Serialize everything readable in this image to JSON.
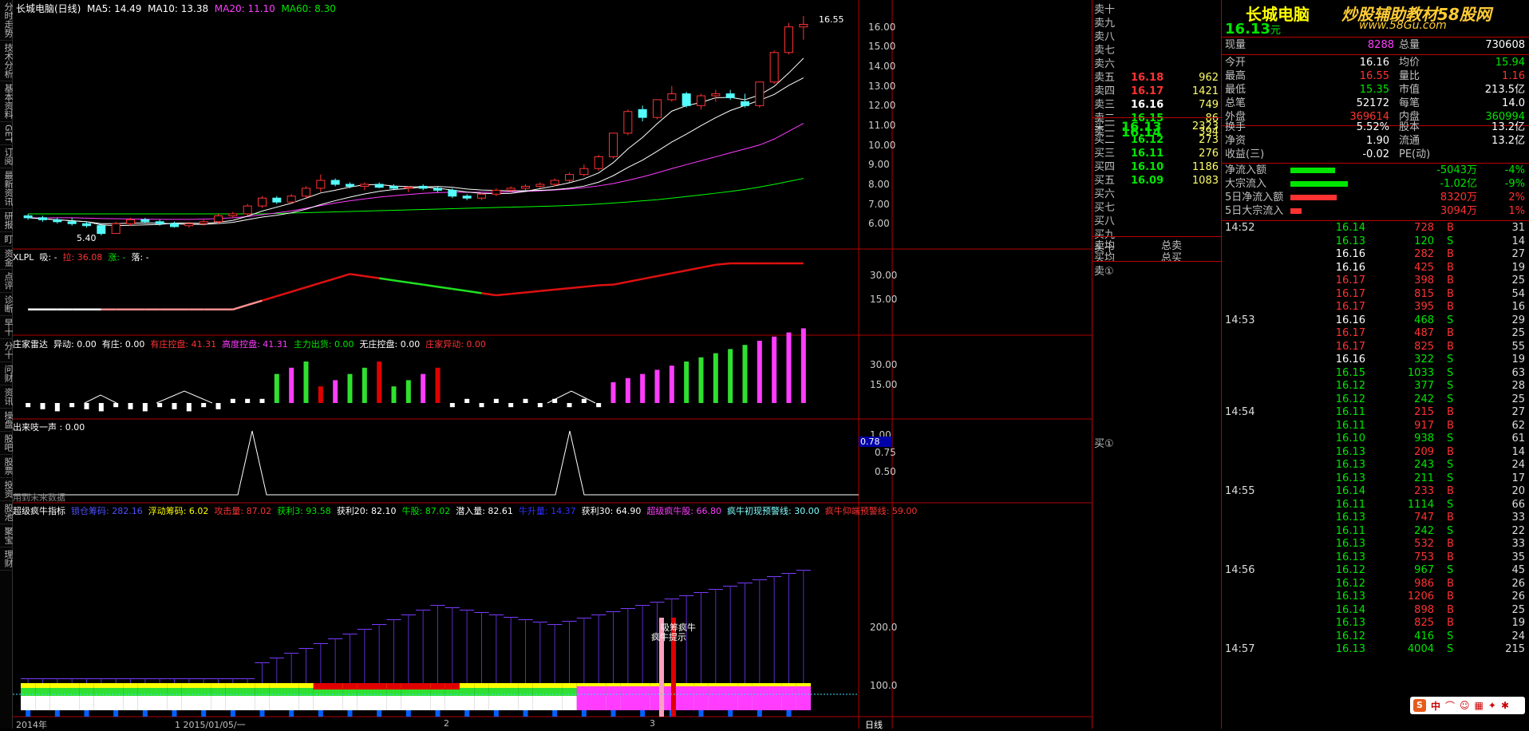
{
  "colors": {
    "up": "#ff3232",
    "down": "#54fcfc",
    "ma5": "#ffffff",
    "ma10": "#ffffff",
    "ma20": "#ff3cff",
    "ma60": "#00ff00",
    "grid": "#1a1a1a",
    "border": "#b00000"
  },
  "side_tabs": [
    "分时走势",
    "技术分析",
    "基本资料",
    "GET",
    "订阅",
    "最新资讯",
    "研报",
    "盯",
    "资金",
    "点评",
    "诊断",
    "早十",
    "分十",
    "问财",
    "资讯",
    "操盘",
    "股吧",
    "股票",
    "投资",
    "股池",
    "聚宝",
    "理财"
  ],
  "main": {
    "title": "长城电脑(日线)",
    "ma5": "MA5: 14.49",
    "ma10": "MA10: 13.38",
    "ma20": "MA20: 11.10",
    "ma60": "MA60: 8.30",
    "price_axis": [
      "16.00",
      "15.00",
      "14.00",
      "13.00",
      "12.00",
      "11.00",
      "10.00",
      "9.00",
      "8.00",
      "7.00",
      "6.00"
    ],
    "high_label": "16.55",
    "low_label": "5.40"
  },
  "p1": {
    "name": "XLPL",
    "a": "吸: -",
    "b": "拉: 36.08",
    "c": "涨: -",
    "d": "落: -",
    "axis": [
      "30.00",
      "15.00"
    ]
  },
  "p2": {
    "name": "庄家雷达",
    "a": "异动: 0.00",
    "b": "有庄: 0.00",
    "c": "有庄控盘: 41.31",
    "d": "高度控盘: 41.31",
    "e": "主力出货: 0.00",
    "f": "无庄控盘: 0.00",
    "g": "庄家异动: 0.00",
    "axis": [
      "30.00",
      "15.00"
    ]
  },
  "p3": {
    "name": "出来吱一声 : 0.00",
    "note": "用到未来数据",
    "axis": [
      "1.00",
      "0.75",
      "0.50"
    ],
    "marker": "0.78"
  },
  "p4": {
    "name": "超级疯牛指标",
    "a": "锁仓筹码: 282.16",
    "b": "浮动筹码: 6.02",
    "c": "攻击量: 87.02",
    "d": "获利3: 93.58",
    "e": "获利20: 82.10",
    "f": "牛股: 87.02",
    "g": "潜入量: 82.61",
    "h": "牛升量: 14.37",
    "i": "获利30: 64.90",
    "j": "超级疯牛股: 66.80",
    "k": "疯牛初现预警线: 30.00",
    "l": "疯牛仰端预警线: 59.00",
    "axis": [
      "200.0",
      "100.0"
    ],
    "ann1": "吸筹疯牛",
    "ann2": "疯牛提示"
  },
  "x_axis": {
    "a": "2014年",
    "b": "1 2015/01/05/一",
    "c": "2",
    "d": "3",
    "period": "日线"
  },
  "chart_data": {
    "type": "candlestick",
    "title": "长城电脑(日线)",
    "candles": [
      [
        6.4,
        6.5,
        6.2,
        6.3
      ],
      [
        6.3,
        6.4,
        6.1,
        6.2
      ],
      [
        6.2,
        6.3,
        6.0,
        6.1
      ],
      [
        6.1,
        6.3,
        5.9,
        6.0
      ],
      [
        6.0,
        6.1,
        5.8,
        5.9
      ],
      [
        5.9,
        6.0,
        5.4,
        5.5
      ],
      [
        5.5,
        6.1,
        5.5,
        6.0
      ],
      [
        6.0,
        6.3,
        5.9,
        6.2
      ],
      [
        6.2,
        6.3,
        6.0,
        6.1
      ],
      [
        6.1,
        6.2,
        5.9,
        6.0
      ],
      [
        6.0,
        6.1,
        5.8,
        5.85
      ],
      [
        5.9,
        6.1,
        5.8,
        6.0
      ],
      [
        6.0,
        6.2,
        5.9,
        6.1
      ],
      [
        6.1,
        6.5,
        6.0,
        6.4
      ],
      [
        6.4,
        6.6,
        6.3,
        6.5
      ],
      [
        6.5,
        7.0,
        6.4,
        6.9
      ],
      [
        6.9,
        7.4,
        6.8,
        7.3
      ],
      [
        7.3,
        7.4,
        7.0,
        7.1
      ],
      [
        7.1,
        7.5,
        7.0,
        7.4
      ],
      [
        7.4,
        7.9,
        7.3,
        7.8
      ],
      [
        7.8,
        8.5,
        7.6,
        8.2
      ],
      [
        8.2,
        8.3,
        7.9,
        8.0
      ],
      [
        8.0,
        8.1,
        7.8,
        7.9
      ],
      [
        7.9,
        8.1,
        7.7,
        8.0
      ],
      [
        8.0,
        8.1,
        7.8,
        7.85
      ],
      [
        7.9,
        8.0,
        7.7,
        7.8
      ],
      [
        7.8,
        7.9,
        7.6,
        7.85
      ],
      [
        7.9,
        8.0,
        7.7,
        7.8
      ],
      [
        7.8,
        7.9,
        7.6,
        7.7
      ],
      [
        7.7,
        7.8,
        7.3,
        7.4
      ],
      [
        7.4,
        7.5,
        7.2,
        7.3
      ],
      [
        7.3,
        7.6,
        7.2,
        7.5
      ],
      [
        7.5,
        7.8,
        7.4,
        7.7
      ],
      [
        7.7,
        7.9,
        7.6,
        7.8
      ],
      [
        7.8,
        8.0,
        7.7,
        7.9
      ],
      [
        7.9,
        8.1,
        7.8,
        8.0
      ],
      [
        8.0,
        8.3,
        7.9,
        8.2
      ],
      [
        8.2,
        8.6,
        8.1,
        8.5
      ],
      [
        8.5,
        9.0,
        8.4,
        8.8
      ],
      [
        8.8,
        9.5,
        8.7,
        9.4
      ],
      [
        9.4,
        10.6,
        9.3,
        10.6
      ],
      [
        10.6,
        11.8,
        10.5,
        11.7
      ],
      [
        11.8,
        12.0,
        11.2,
        11.4
      ],
      [
        11.4,
        12.3,
        11.3,
        12.3
      ],
      [
        12.3,
        13.0,
        12.2,
        12.6
      ],
      [
        12.6,
        12.7,
        11.9,
        12.0
      ],
      [
        12.0,
        12.6,
        11.8,
        12.5
      ],
      [
        12.5,
        12.8,
        12.2,
        12.6
      ],
      [
        12.6,
        12.8,
        12.3,
        12.4
      ],
      [
        12.2,
        12.6,
        11.9,
        12.0
      ],
      [
        12.0,
        13.2,
        11.9,
        13.2
      ],
      [
        13.2,
        14.8,
        13.1,
        14.7
      ],
      [
        14.7,
        16.2,
        14.6,
        16.0
      ],
      [
        16.0,
        16.55,
        15.35,
        16.13
      ]
    ],
    "ma20": [
      6.3,
      6.3,
      6.3,
      6.3,
      6.28,
      6.26,
      6.25,
      6.24,
      6.23,
      6.22,
      6.22,
      6.22,
      6.23,
      6.26,
      6.3,
      6.36,
      6.45,
      6.55,
      6.65,
      6.78,
      6.92,
      7.05,
      7.16,
      7.26,
      7.35,
      7.42,
      7.48,
      7.54,
      7.58,
      7.6,
      7.6,
      7.6,
      7.6,
      7.62,
      7.64,
      7.67,
      7.71,
      7.76,
      7.83,
      7.92,
      8.04,
      8.2,
      8.38,
      8.58,
      8.8,
      9.0,
      9.2,
      9.4,
      9.6,
      9.8,
      10.0,
      10.3,
      10.7,
      11.1
    ],
    "ma60": [
      6.5,
      6.5,
      6.5,
      6.5,
      6.5,
      6.5,
      6.5,
      6.5,
      6.5,
      6.5,
      6.5,
      6.5,
      6.5,
      6.5,
      6.5,
      6.5,
      6.5,
      6.52,
      6.54,
      6.56,
      6.58,
      6.6,
      6.62,
      6.64,
      6.66,
      6.68,
      6.7,
      6.72,
      6.74,
      6.76,
      6.78,
      6.8,
      6.82,
      6.84,
      6.86,
      6.88,
      6.9,
      6.93,
      6.96,
      7.0,
      7.05,
      7.1,
      7.16,
      7.22,
      7.3,
      7.38,
      7.46,
      7.55,
      7.64,
      7.74,
      7.86,
      8.0,
      8.15,
      8.3
    ]
  },
  "quote": {
    "name": "长城电脑",
    "watermark": "炒股辅助教材58股网",
    "watermark_sub": "www.58Gu.com",
    "price": "16.13",
    "price_unit": "元",
    "vol_label": "现量",
    "vol": "8288",
    "total_label": "总量",
    "total": "730608",
    "asks_labels": [
      "卖十",
      "卖九",
      "卖八",
      "卖七",
      "卖六",
      "卖五",
      "卖四",
      "卖三",
      "卖二",
      "卖一"
    ],
    "asks": [
      [
        "",
        ""
      ],
      [
        "",
        ""
      ],
      [
        "",
        ""
      ],
      [
        "",
        ""
      ],
      [
        "",
        ""
      ],
      [
        "16.18",
        "962"
      ],
      [
        "16.17",
        "1421"
      ],
      [
        "16.16",
        "749"
      ],
      [
        "16.15",
        "86"
      ],
      [
        "16.14",
        "394"
      ]
    ],
    "bids_labels": [
      "买一",
      "买二",
      "买三",
      "买四",
      "买五",
      "买六",
      "买七",
      "买八",
      "买九",
      "买十"
    ],
    "bids": [
      [
        "16.13",
        "2323"
      ],
      [
        "16.12",
        "273"
      ],
      [
        "16.11",
        "276"
      ],
      [
        "16.10",
        "1186"
      ],
      [
        "16.09",
        "1083"
      ],
      [
        "",
        ""
      ],
      [
        "",
        ""
      ],
      [
        "",
        ""
      ],
      [
        "",
        ""
      ],
      [
        "",
        ""
      ]
    ],
    "avg_sell": "卖均",
    "avg_buy": "买均",
    "total_sell": "总卖",
    "total_buy": "总买",
    "sell1": "卖①",
    "buy1": "买①",
    "stats": [
      [
        "今开",
        "16.16",
        "均价",
        "15.94"
      ],
      [
        "最高",
        "16.55",
        "量比",
        "1.16"
      ],
      [
        "最低",
        "15.35",
        "市值",
        "213.5亿"
      ],
      [
        "总笔",
        "52172",
        "每笔",
        "14.0"
      ],
      [
        "外盘",
        "369614",
        "内盘",
        "360994"
      ]
    ],
    "stats2": [
      [
        "换手",
        "5.52%",
        "股本",
        "13.2亿"
      ],
      [
        "净资",
        "1.90",
        "流通",
        "13.2亿"
      ],
      [
        "收益(三)",
        "-0.02",
        "PE(动)",
        ""
      ]
    ],
    "flows": [
      [
        "净流入额",
        "-5043万",
        "-4%"
      ],
      [
        "大宗流入",
        "-1.02亿",
        "-9%"
      ],
      [
        "5日净流入额",
        "8320万",
        "2%"
      ],
      [
        "5日大宗流入",
        "3094万",
        "1%"
      ]
    ],
    "ticks": [
      [
        "14:52",
        "16.14",
        "728",
        "B",
        "31"
      ],
      [
        "",
        "16.13",
        "120",
        "S",
        "14"
      ],
      [
        "",
        "16.16",
        "282",
        "B",
        "27"
      ],
      [
        "",
        "16.16",
        "425",
        "B",
        "19"
      ],
      [
        "",
        "16.17",
        "398",
        "B",
        "25"
      ],
      [
        "",
        "16.17",
        "815",
        "B",
        "54"
      ],
      [
        "",
        "16.17",
        "395",
        "B",
        "16"
      ],
      [
        "14:53",
        "16.16",
        "468",
        "S",
        "29"
      ],
      [
        "",
        "16.17",
        "487",
        "B",
        "25"
      ],
      [
        "",
        "16.17",
        "825",
        "B",
        "55"
      ],
      [
        "",
        "16.16",
        "322",
        "S",
        "19"
      ],
      [
        "",
        "16.15",
        "1033",
        "S",
        "63"
      ],
      [
        "",
        "16.12",
        "377",
        "S",
        "28"
      ],
      [
        "",
        "16.12",
        "242",
        "S",
        "25"
      ],
      [
        "14:54",
        "16.11",
        "215",
        "B",
        "27"
      ],
      [
        "",
        "16.11",
        "917",
        "B",
        "62"
      ],
      [
        "",
        "16.10",
        "938",
        "S",
        "61"
      ],
      [
        "",
        "16.13",
        "209",
        "B",
        "14"
      ],
      [
        "",
        "16.13",
        "243",
        "S",
        "24"
      ],
      [
        "",
        "16.13",
        "211",
        "S",
        "17"
      ],
      [
        "14:55",
        "16.14",
        "233",
        "B",
        "20"
      ],
      [
        "",
        "16.11",
        "1114",
        "S",
        "66"
      ],
      [
        "",
        "16.13",
        "747",
        "B",
        "33"
      ],
      [
        "",
        "16.11",
        "242",
        "S",
        "22"
      ],
      [
        "",
        "16.13",
        "532",
        "B",
        "33"
      ],
      [
        "",
        "16.13",
        "753",
        "B",
        "35"
      ],
      [
        "14:56",
        "16.12",
        "967",
        "S",
        "45"
      ],
      [
        "",
        "16.12",
        "986",
        "B",
        "26"
      ],
      [
        "",
        "16.13",
        "1206",
        "B",
        "26"
      ],
      [
        "",
        "16.14",
        "898",
        "B",
        "25"
      ],
      [
        "",
        "16.13",
        "825",
        "B",
        "19"
      ],
      [
        "",
        "16.12",
        "416",
        "S",
        "24"
      ],
      [
        "14:57",
        "16.13",
        "4004",
        "S",
        "215"
      ]
    ]
  }
}
